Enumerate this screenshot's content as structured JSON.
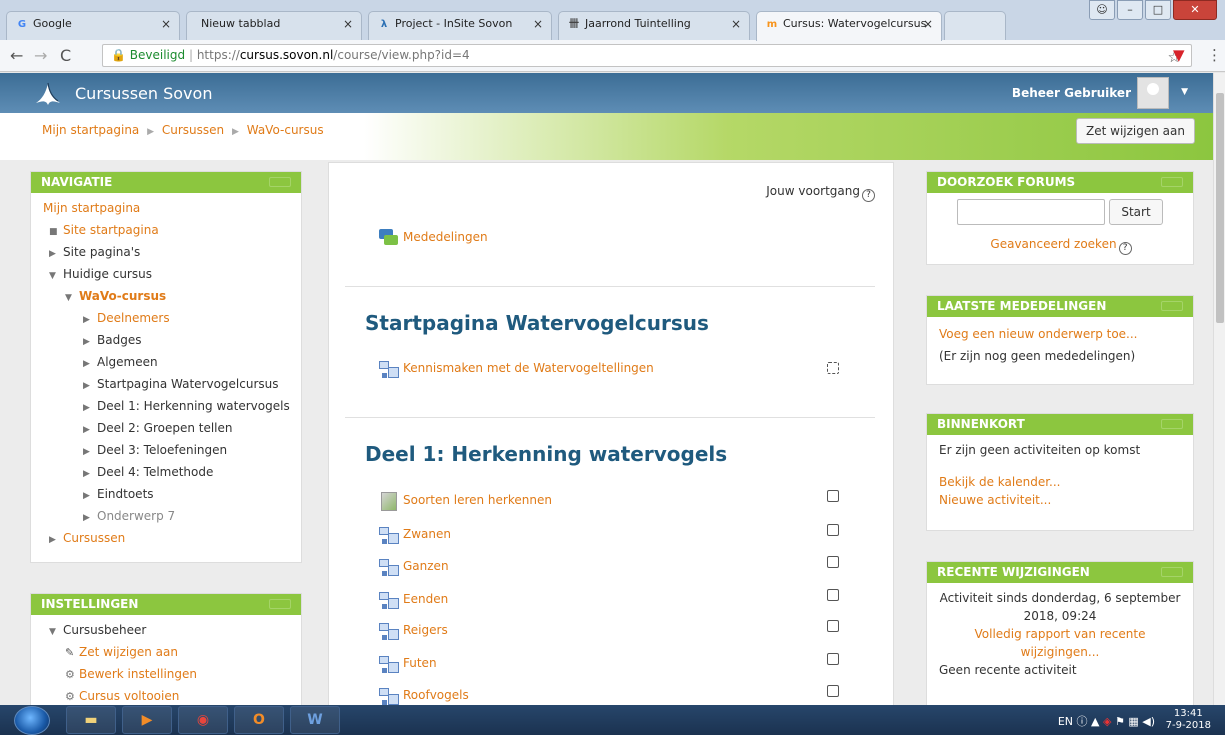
{
  "browser": {
    "tabs": [
      {
        "label": "Google",
        "icon": "google-icon",
        "active": false
      },
      {
        "label": "Nieuw tabblad",
        "icon": "blank-icon",
        "active": false
      },
      {
        "label": "Project - InSite Sovon",
        "icon": "insite-icon",
        "active": false
      },
      {
        "label": "Jaarrond Tuintelling",
        "icon": "tuintelling-icon",
        "active": false
      },
      {
        "label": "Cursus: Watervogelcursus",
        "icon": "moodle-icon",
        "active": true
      }
    ],
    "secure_label": "Beveiligd",
    "url_scheme": "https://",
    "url_host": "cursus.sovon.nl",
    "url_path": "/course/view.php?id=4"
  },
  "site": {
    "name": "Cursussen Sovon",
    "user": "Beheer Gebruiker"
  },
  "breadcrumb": [
    "Mijn startpagina",
    "Cursussen",
    "WaVo-cursus"
  ],
  "edit_button": "Zet wijzigen aan",
  "navigation": {
    "title": "NAVIGATIE",
    "items": [
      {
        "label": "Mijn startpagina"
      },
      {
        "label": "Site startpagina"
      },
      {
        "label": "Site pagina's"
      },
      {
        "label": "Huidige cursus"
      },
      {
        "label": "WaVo-cursus"
      },
      {
        "label": "Deelnemers"
      },
      {
        "label": "Badges"
      },
      {
        "label": "Algemeen"
      },
      {
        "label": "Startpagina Watervogelcursus"
      },
      {
        "label": "Deel 1: Herkenning watervogels"
      },
      {
        "label": "Deel 2: Groepen tellen"
      },
      {
        "label": "Deel 3: Teloefeningen"
      },
      {
        "label": "Deel 4: Telmethode"
      },
      {
        "label": "Eindtoets"
      },
      {
        "label": "Onderwerp 7"
      },
      {
        "label": "Cursussen"
      }
    ]
  },
  "settings": {
    "title": "INSTELLINGEN",
    "items": [
      {
        "label": "Cursusbeheer"
      },
      {
        "label": "Zet wijzigen aan"
      },
      {
        "label": "Bewerk instellingen"
      },
      {
        "label": "Cursus voltooien"
      }
    ]
  },
  "main": {
    "progress_label": "Jouw voortgang",
    "announcements": "Mededelingen",
    "section1": {
      "title": "Startpagina Watervogelcursus",
      "activities": [
        {
          "label": "Kennismaken met de Watervogeltellingen"
        }
      ]
    },
    "section2": {
      "title": "Deel 1: Herkenning watervogels",
      "activities": [
        {
          "label": "Soorten leren herkennen"
        },
        {
          "label": "Zwanen"
        },
        {
          "label": "Ganzen"
        },
        {
          "label": "Eenden"
        },
        {
          "label": "Reigers"
        },
        {
          "label": "Futen"
        },
        {
          "label": "Roofvogels"
        }
      ]
    }
  },
  "search_forums": {
    "title": "DOORZOEK FORUMS",
    "button": "Start",
    "advanced": "Geavanceerd zoeken"
  },
  "latest_news": {
    "title": "LAATSTE MEDEDELINGEN",
    "add_link": "Voeg een nieuw onderwerp toe...",
    "empty": "(Er zijn nog geen mededelingen)"
  },
  "upcoming": {
    "title": "BINNENKORT",
    "empty": "Er zijn geen activiteiten op komst",
    "calendar_link": "Bekijk de kalender...",
    "new_event": "Nieuwe activiteit..."
  },
  "recent": {
    "title": "RECENTE WIJZIGINGEN",
    "since_line1": "Activiteit sinds donderdag, 6 september",
    "since_line2": "2018, 09:24",
    "report_link1": "Volledig rapport van recente",
    "report_link2": "wijzigingen...",
    "none": "Geen recente activiteit"
  },
  "taskbar": {
    "lang": "EN",
    "time": "13:41",
    "date": "7-9-2018"
  },
  "colors": {
    "accent_green": "#8cc63f",
    "link_orange": "#e07b18",
    "header_blue": "#3c6d95",
    "section_title": "#1f5a7e"
  }
}
